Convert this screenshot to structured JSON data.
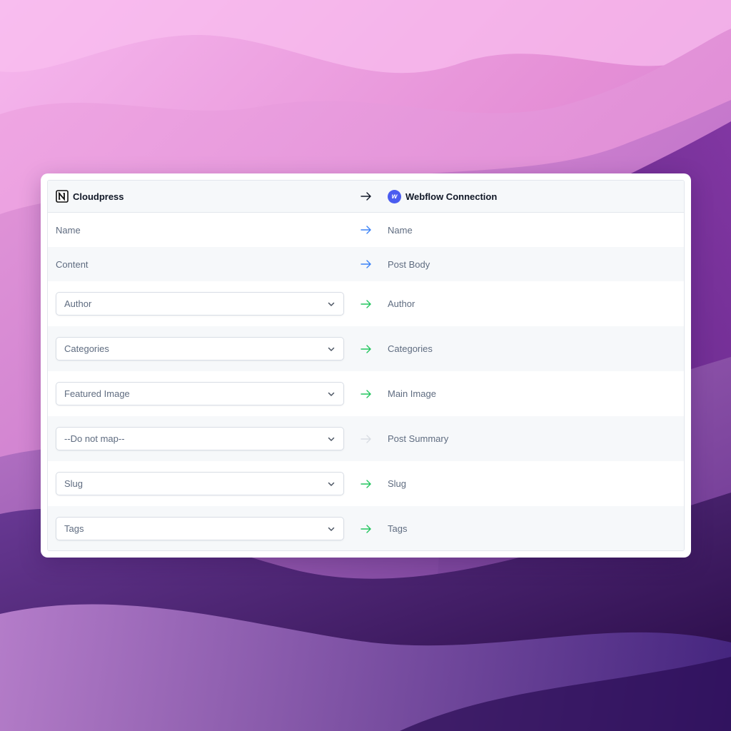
{
  "header": {
    "source_label": "Cloudpress",
    "source_icon": "notion-icon",
    "dest_label": "Webflow Connection",
    "dest_icon": "webflow-icon",
    "webflow_logo_letter": "w"
  },
  "colors": {
    "blue_arrow": "#3b82f6",
    "green_arrow": "#22c55e",
    "disabled_arrow": "#d9dde3",
    "header_arrow": "#111827"
  },
  "mappings": [
    {
      "source": "Name",
      "source_type": "text",
      "dest": "Name",
      "arrow": "blue"
    },
    {
      "source": "Content",
      "source_type": "text",
      "dest": "Post Body",
      "arrow": "blue"
    },
    {
      "source": "Author",
      "source_type": "select",
      "dest": "Author",
      "arrow": "green"
    },
    {
      "source": "Categories",
      "source_type": "select",
      "dest": "Categories",
      "arrow": "green"
    },
    {
      "source": "Featured Image",
      "source_type": "select",
      "dest": "Main Image",
      "arrow": "green"
    },
    {
      "source": "--Do not map--",
      "source_type": "select",
      "dest": "Post Summary",
      "arrow": "disabled"
    },
    {
      "source": "Slug",
      "source_type": "select",
      "dest": "Slug",
      "arrow": "green"
    },
    {
      "source": "Tags",
      "source_type": "select",
      "dest": "Tags",
      "arrow": "green"
    }
  ]
}
